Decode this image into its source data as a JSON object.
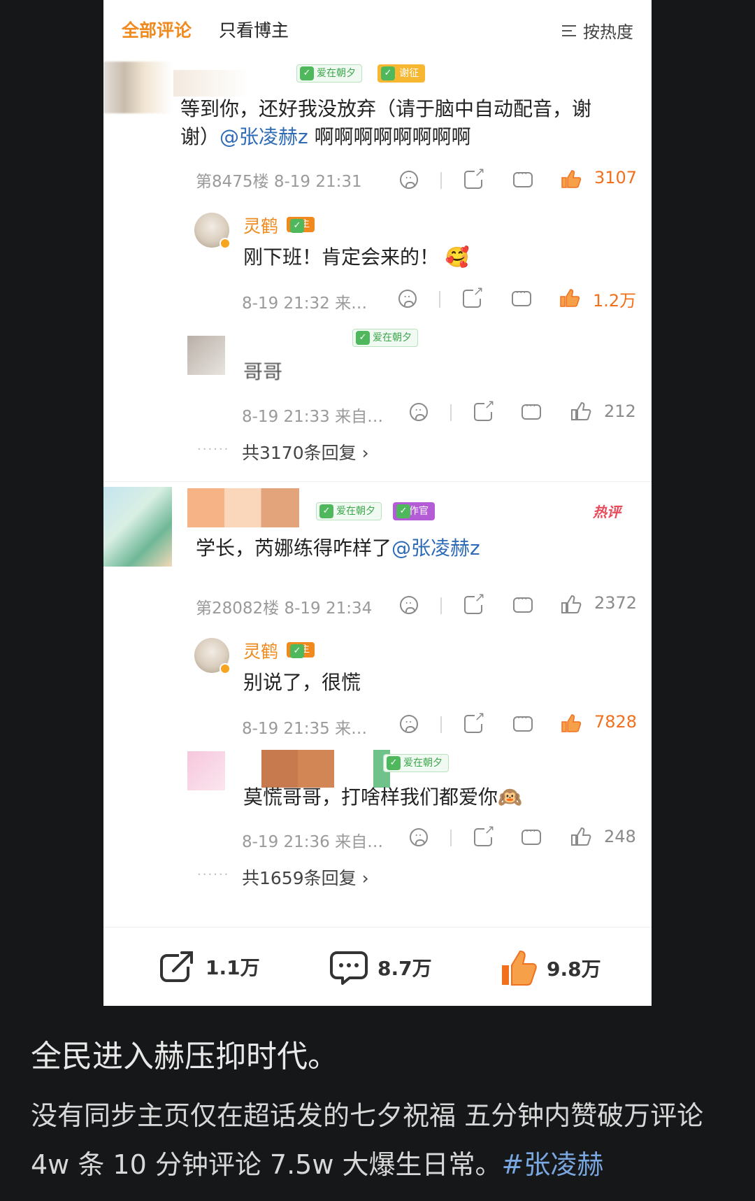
{
  "tabs": {
    "all": "全部评论",
    "blogger_only": "只看博主",
    "sort": "按热度"
  },
  "comments": [
    {
      "badges": [
        "爱在朝夕",
        "11 谢征"
      ],
      "text": "等到你，还好我没放弃（请于脑中自动配音，谢谢）",
      "mention": "@张凌赫z",
      "tail": "啊啊啊啊啊啊啊啊",
      "meta": "第8475楼 8-19 21:31",
      "likes": "3107",
      "reply": {
        "name": "灵鹤",
        "owner_badge": "博主",
        "text": "刚下班！肯定会来的！",
        "meta": "8-19 21:32 来…",
        "likes": "1.2万"
      },
      "sub": {
        "badge": "爱在朝夕",
        "text": "哥哥",
        "meta": "8-19 21:33 来自…",
        "likes": "212"
      },
      "more": "共3170条回复"
    },
    {
      "badges": [
        "爱在朝夕",
        "创作官"
      ],
      "hot": "热评",
      "text": "学长，芮娜练得咋样了",
      "mention": "@张凌赫z",
      "meta": "第28082楼 8-19 21:34",
      "likes": "2372",
      "reply": {
        "name": "灵鹤",
        "owner_badge": "博主",
        "text": "别说了，很慌",
        "meta": "8-19 21:35 来…",
        "likes": "7828"
      },
      "sub": {
        "badge": "爱在朝夕",
        "text": "莫慌哥哥，打啥样我们都爱你",
        "meta": "8-19 21:36 来自…",
        "likes": "248"
      },
      "more": "共1659条回复"
    }
  ],
  "bottom_bar": {
    "share": "1.1万",
    "comments": "8.7万",
    "likes": "9.8万"
  },
  "caption": {
    "title": "全民进入赫压抑时代。",
    "body": "没有同步主页仅在超话发的七夕祝福 五分钟内赞破万评论 4w 条 10 分钟评论 7.5w 大爆生日常。",
    "hashtag": "#张凌赫"
  },
  "colors": {
    "accent": "#f08a1e",
    "mention": "#2e6bb7",
    "hot": "#e94b5a"
  }
}
